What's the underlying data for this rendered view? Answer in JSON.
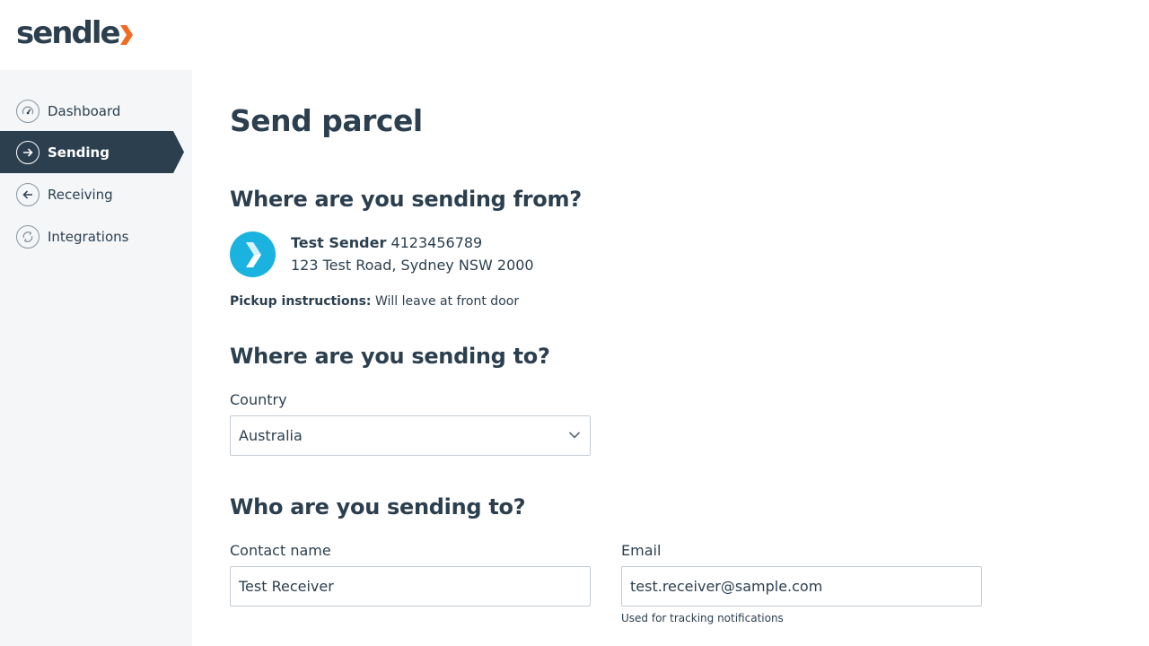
{
  "brand": {
    "logo_text": "sendle",
    "logo_text_color": "#2b3f4f",
    "logo_accent_color": "#f26b21"
  },
  "sidebar": {
    "items": [
      {
        "label": "Dashboard",
        "icon": "gauge-icon",
        "active": false
      },
      {
        "label": "Sending",
        "icon": "arrow-right-circle-icon",
        "active": true
      },
      {
        "label": "Receiving",
        "icon": "arrow-left-circle-icon",
        "active": false
      },
      {
        "label": "Integrations",
        "icon": "sync-icon",
        "active": false
      }
    ],
    "active_color": "#2b3f4f"
  },
  "page": {
    "title": "Send parcel"
  },
  "from_section": {
    "heading": "Where are you sending from?",
    "sender_name": "Test Sender",
    "sender_phone": "4123456789",
    "sender_address": "123 Test Road, Sydney NSW 2000",
    "avatar_color": "#1ab3e0",
    "pickup_label": "Pickup instructions:",
    "pickup_value": "Will leave at front door"
  },
  "to_section": {
    "heading": "Where are you sending to?",
    "country_label": "Country",
    "country_value": "Australia"
  },
  "who_section": {
    "heading": "Who are you sending to?",
    "contact_label": "Contact name",
    "contact_value": "Test Receiver",
    "email_label": "Email",
    "email_value": "test.receiver@sample.com",
    "email_hint": "Used for tracking notifications"
  }
}
